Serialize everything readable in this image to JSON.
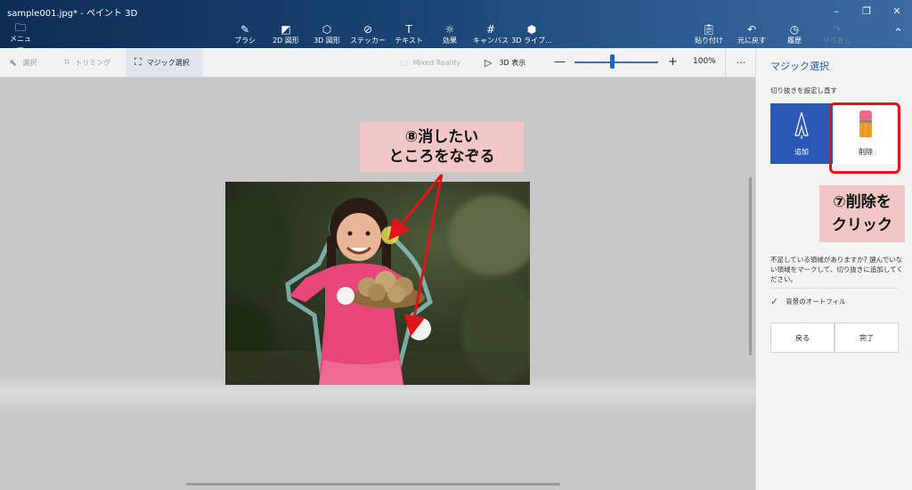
{
  "window": {
    "title": "sample001.jpg* - ペイント 3D"
  },
  "menu": {
    "label": "メニュー"
  },
  "toolbar": {
    "tools": [
      {
        "name": "brush",
        "label": "ブラシ"
      },
      {
        "name": "2d-shapes",
        "label": "2D 図形"
      },
      {
        "name": "3d-shapes",
        "label": "3D 図形"
      },
      {
        "name": "stickers",
        "label": "ステッカー"
      },
      {
        "name": "text",
        "label": "テキスト"
      },
      {
        "name": "effects",
        "label": "効果"
      },
      {
        "name": "canvas",
        "label": "キャンバス"
      },
      {
        "name": "3d-library",
        "label": "3D ライブ..."
      }
    ],
    "right_tools": [
      {
        "name": "paste",
        "label": "貼り付け"
      },
      {
        "name": "undo",
        "label": "元に戻す"
      },
      {
        "name": "history",
        "label": "履歴"
      },
      {
        "name": "redo",
        "label": "やり直し"
      }
    ]
  },
  "selection_bar": {
    "select": "選択",
    "crop": "トリミング",
    "magic_select": "マジック選択",
    "mixed_reality": "Mixed Reality",
    "view_3d": "3D 表示",
    "zoom": "100%",
    "zoom_fraction": 0.45
  },
  "panel": {
    "title": "マジック選択",
    "subtitle": "切り抜きを設定し直す",
    "add_label": "追加",
    "remove_label": "削除",
    "description": "不足している領域がありますか? 選んでいない領域をマークして、切り抜きに追加してください。",
    "autofill_label": "背景のオートフィル",
    "autofill_checked": true,
    "back_label": "戻る",
    "done_label": "完了"
  },
  "annotations": {
    "step8": "⑧消したい\nところをなぞる",
    "step8_line1": "⑧消したい",
    "step8_line2": "ところをなぞる",
    "step7_line1": "⑦削除を",
    "step7_line2": "クリック"
  },
  "colors": {
    "accent": "#1f63c8",
    "annotation_bg": "#f0c6c6",
    "highlight": "#e0151a"
  }
}
